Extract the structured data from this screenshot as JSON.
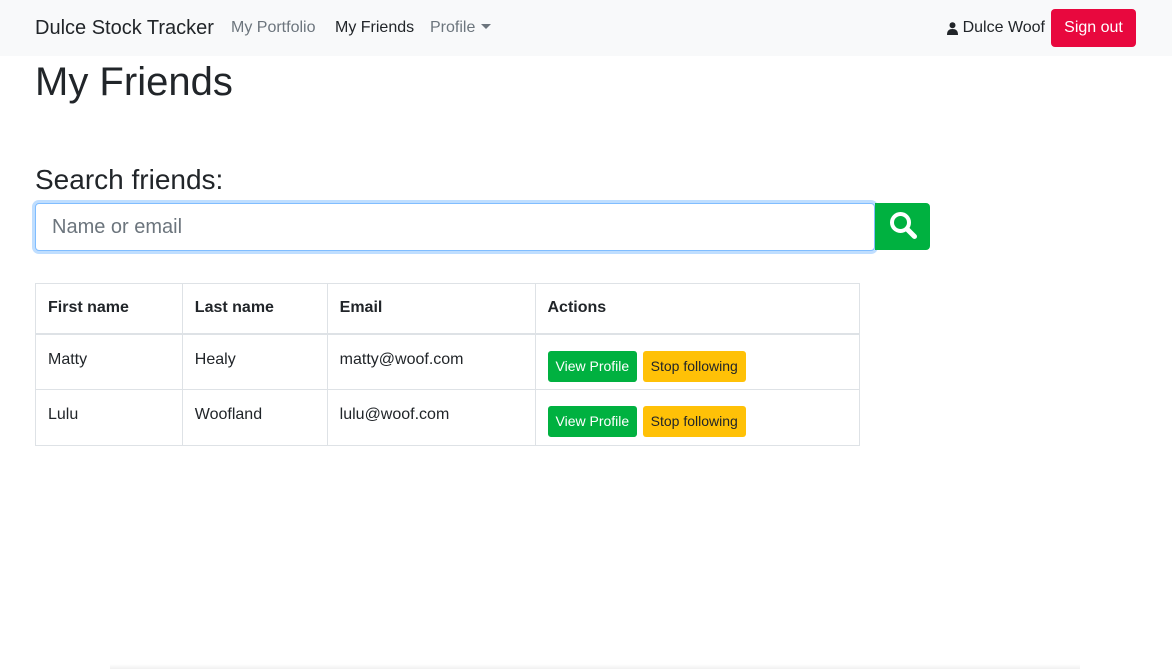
{
  "navbar": {
    "brand": "Dulce Stock Tracker",
    "links": [
      {
        "label": "My Portfolio"
      },
      {
        "label": "My Friends"
      },
      {
        "label": "Profile"
      }
    ],
    "user_name": "Dulce Woof",
    "signout_label": "Sign out"
  },
  "page": {
    "title": "My Friends"
  },
  "search": {
    "heading": "Search friends:",
    "placeholder": "Name or email",
    "value": ""
  },
  "table": {
    "headers": [
      "First name",
      "Last name",
      "Email",
      "Actions"
    ],
    "rows": [
      {
        "first": "Matty",
        "last": "Healy",
        "email": "matty@woof.com",
        "view_label": "View Profile",
        "stop_label": "Stop following"
      },
      {
        "first": "Lulu",
        "last": "Woofland",
        "email": "lulu@woof.com",
        "view_label": "View Profile",
        "stop_label": "Stop following"
      }
    ]
  },
  "colors": {
    "accent_green": "#00b140",
    "signout_red": "#e8083e",
    "warning_yellow": "#ffc107",
    "navbar_bg": "#f8f9fa"
  },
  "icons": {
    "user": "user-icon",
    "search": "search-icon",
    "dropdown": "caret-down-icon"
  }
}
